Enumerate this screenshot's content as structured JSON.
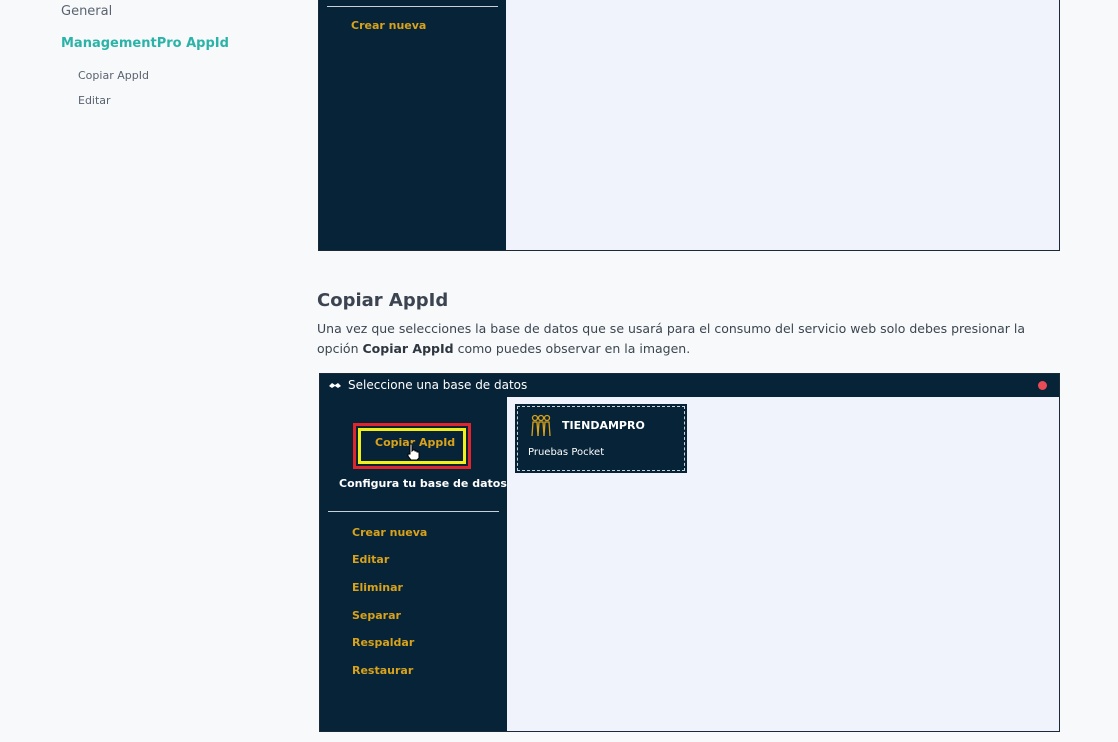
{
  "nav": {
    "general": "General",
    "active": "ManagementPro AppId",
    "sub_items": [
      "Copiar AppId",
      "Editar"
    ]
  },
  "screenshot_top": {
    "crear_nueva": "Crear nueva"
  },
  "section": {
    "title": "Copiar AppId",
    "para_before": "Una vez que selecciones la base de datos que se usará para el consumo del servicio web solo debes presionar la opción ",
    "para_bold": "Copiar AppId",
    "para_after": " como puedes observar en la imagen."
  },
  "screenshot_bottom": {
    "window_title": "Seleccione una base de datos",
    "copiar_button": "Copiar AppId",
    "config_label": "Configura tu base de datos",
    "menu": [
      "Crear nueva",
      "Editar",
      "Eliminar",
      "Separar",
      "Respaldar",
      "Restaurar"
    ],
    "database": {
      "name": "TIENDAMPRO",
      "description": "Pruebas Pocket"
    }
  },
  "colors": {
    "dark_panel": "#062338",
    "menu_text": "#d9a21b",
    "accent_nav": "#2bb3a8",
    "highlight_red": "#e0262c",
    "highlight_yellow": "#f2ef1a",
    "close_dot": "#e84b56"
  }
}
